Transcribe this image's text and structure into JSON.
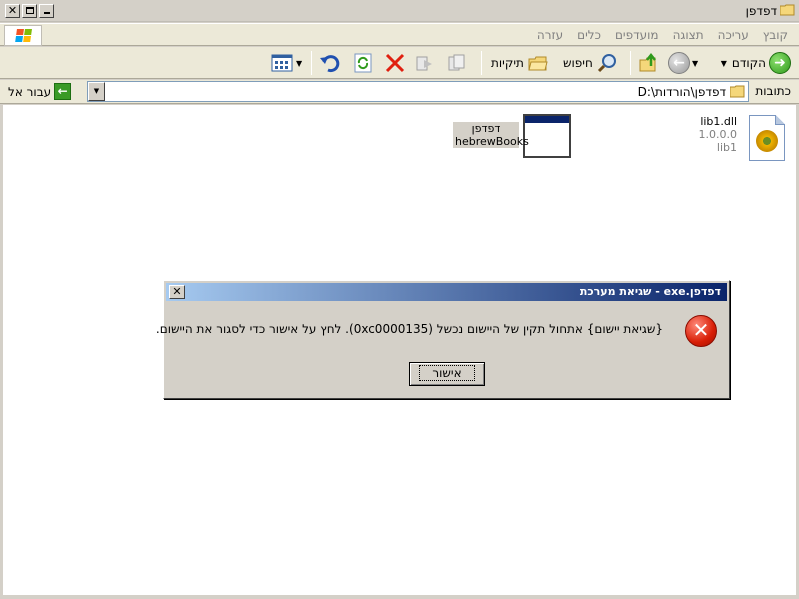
{
  "window": {
    "title": "דפדפן",
    "icon": "folder-icon"
  },
  "menu": {
    "items": [
      "קובץ",
      "עריכה",
      "תצוגה",
      "מועדפים",
      "כלים",
      "עזרה"
    ]
  },
  "toolbar": {
    "back_label": "הקודם",
    "search_label": "חיפוש",
    "folders_label": "תיקיות"
  },
  "address": {
    "label": "כתובות",
    "path": "D:\\דפדפן\\הורדות",
    "go_label": "עבור אל"
  },
  "files": [
    {
      "name": "lib1.dll",
      "version": "1.0.0.0",
      "description": "lib1",
      "icon": "dll-file-icon"
    },
    {
      "name": "דפדפן",
      "description": "hebrewBooks",
      "icon": "exe-window-icon"
    }
  ],
  "dialog": {
    "title": "דפדפן.exe - שגיאת מערכת",
    "message": "{שגיאת יישום} אתחול תקין של היישום נכשל (0xc0000135). לחץ על אישור כדי לסגור את היישום.",
    "ok_label": "אישור",
    "icon": "error-icon"
  },
  "colors": {
    "dialog_title_start": "#0a246a",
    "dialog_title_end": "#a6caf0",
    "error_red": "#d81e06",
    "go_green": "#3a9a26"
  }
}
